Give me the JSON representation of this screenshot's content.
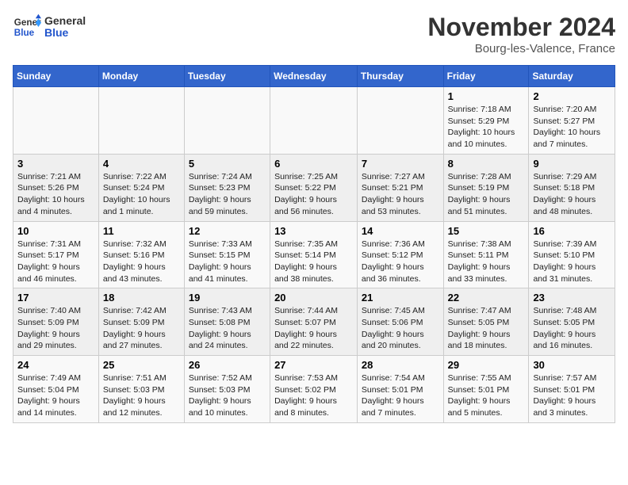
{
  "header": {
    "logo_line1": "General",
    "logo_line2": "Blue",
    "month": "November 2024",
    "location": "Bourg-les-Valence, France"
  },
  "weekdays": [
    "Sunday",
    "Monday",
    "Tuesday",
    "Wednesday",
    "Thursday",
    "Friday",
    "Saturday"
  ],
  "weeks": [
    [
      {
        "day": "",
        "info": ""
      },
      {
        "day": "",
        "info": ""
      },
      {
        "day": "",
        "info": ""
      },
      {
        "day": "",
        "info": ""
      },
      {
        "day": "",
        "info": ""
      },
      {
        "day": "1",
        "info": "Sunrise: 7:18 AM\nSunset: 5:29 PM\nDaylight: 10 hours and 10 minutes."
      },
      {
        "day": "2",
        "info": "Sunrise: 7:20 AM\nSunset: 5:27 PM\nDaylight: 10 hours and 7 minutes."
      }
    ],
    [
      {
        "day": "3",
        "info": "Sunrise: 7:21 AM\nSunset: 5:26 PM\nDaylight: 10 hours and 4 minutes."
      },
      {
        "day": "4",
        "info": "Sunrise: 7:22 AM\nSunset: 5:24 PM\nDaylight: 10 hours and 1 minute."
      },
      {
        "day": "5",
        "info": "Sunrise: 7:24 AM\nSunset: 5:23 PM\nDaylight: 9 hours and 59 minutes."
      },
      {
        "day": "6",
        "info": "Sunrise: 7:25 AM\nSunset: 5:22 PM\nDaylight: 9 hours and 56 minutes."
      },
      {
        "day": "7",
        "info": "Sunrise: 7:27 AM\nSunset: 5:21 PM\nDaylight: 9 hours and 53 minutes."
      },
      {
        "day": "8",
        "info": "Sunrise: 7:28 AM\nSunset: 5:19 PM\nDaylight: 9 hours and 51 minutes."
      },
      {
        "day": "9",
        "info": "Sunrise: 7:29 AM\nSunset: 5:18 PM\nDaylight: 9 hours and 48 minutes."
      }
    ],
    [
      {
        "day": "10",
        "info": "Sunrise: 7:31 AM\nSunset: 5:17 PM\nDaylight: 9 hours and 46 minutes."
      },
      {
        "day": "11",
        "info": "Sunrise: 7:32 AM\nSunset: 5:16 PM\nDaylight: 9 hours and 43 minutes."
      },
      {
        "day": "12",
        "info": "Sunrise: 7:33 AM\nSunset: 5:15 PM\nDaylight: 9 hours and 41 minutes."
      },
      {
        "day": "13",
        "info": "Sunrise: 7:35 AM\nSunset: 5:14 PM\nDaylight: 9 hours and 38 minutes."
      },
      {
        "day": "14",
        "info": "Sunrise: 7:36 AM\nSunset: 5:12 PM\nDaylight: 9 hours and 36 minutes."
      },
      {
        "day": "15",
        "info": "Sunrise: 7:38 AM\nSunset: 5:11 PM\nDaylight: 9 hours and 33 minutes."
      },
      {
        "day": "16",
        "info": "Sunrise: 7:39 AM\nSunset: 5:10 PM\nDaylight: 9 hours and 31 minutes."
      }
    ],
    [
      {
        "day": "17",
        "info": "Sunrise: 7:40 AM\nSunset: 5:09 PM\nDaylight: 9 hours and 29 minutes."
      },
      {
        "day": "18",
        "info": "Sunrise: 7:42 AM\nSunset: 5:09 PM\nDaylight: 9 hours and 27 minutes."
      },
      {
        "day": "19",
        "info": "Sunrise: 7:43 AM\nSunset: 5:08 PM\nDaylight: 9 hours and 24 minutes."
      },
      {
        "day": "20",
        "info": "Sunrise: 7:44 AM\nSunset: 5:07 PM\nDaylight: 9 hours and 22 minutes."
      },
      {
        "day": "21",
        "info": "Sunrise: 7:45 AM\nSunset: 5:06 PM\nDaylight: 9 hours and 20 minutes."
      },
      {
        "day": "22",
        "info": "Sunrise: 7:47 AM\nSunset: 5:05 PM\nDaylight: 9 hours and 18 minutes."
      },
      {
        "day": "23",
        "info": "Sunrise: 7:48 AM\nSunset: 5:05 PM\nDaylight: 9 hours and 16 minutes."
      }
    ],
    [
      {
        "day": "24",
        "info": "Sunrise: 7:49 AM\nSunset: 5:04 PM\nDaylight: 9 hours and 14 minutes."
      },
      {
        "day": "25",
        "info": "Sunrise: 7:51 AM\nSunset: 5:03 PM\nDaylight: 9 hours and 12 minutes."
      },
      {
        "day": "26",
        "info": "Sunrise: 7:52 AM\nSunset: 5:03 PM\nDaylight: 9 hours and 10 minutes."
      },
      {
        "day": "27",
        "info": "Sunrise: 7:53 AM\nSunset: 5:02 PM\nDaylight: 9 hours and 8 minutes."
      },
      {
        "day": "28",
        "info": "Sunrise: 7:54 AM\nSunset: 5:01 PM\nDaylight: 9 hours and 7 minutes."
      },
      {
        "day": "29",
        "info": "Sunrise: 7:55 AM\nSunset: 5:01 PM\nDaylight: 9 hours and 5 minutes."
      },
      {
        "day": "30",
        "info": "Sunrise: 7:57 AM\nSunset: 5:01 PM\nDaylight: 9 hours and 3 minutes."
      }
    ]
  ]
}
